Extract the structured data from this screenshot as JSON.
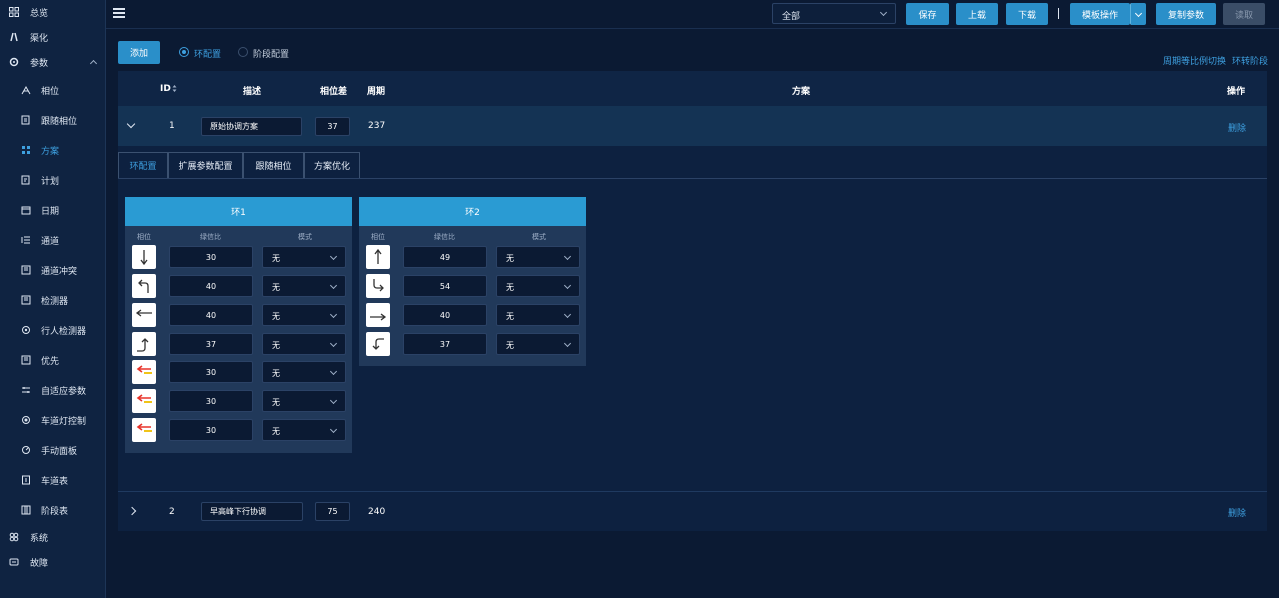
{
  "sidebar": {
    "items": [
      {
        "label": "总览",
        "icon": "grid-icon"
      },
      {
        "label": "渠化",
        "icon": "road-icon"
      },
      {
        "label": "参数",
        "icon": "gear-icon"
      },
      {
        "label": "相位",
        "icon": "phase-icon"
      },
      {
        "label": "跟随相位",
        "icon": "follow-phase-icon"
      },
      {
        "label": "方案",
        "icon": "scheme-icon"
      },
      {
        "label": "计划",
        "icon": "plan-icon"
      },
      {
        "label": "日期",
        "icon": "calendar-icon"
      },
      {
        "label": "通道",
        "icon": "channel-icon"
      },
      {
        "label": "通道冲突",
        "icon": "conflict-icon"
      },
      {
        "label": "检测器",
        "icon": "detector-icon"
      },
      {
        "label": "行人检测器",
        "icon": "pedestrian-detector-icon"
      },
      {
        "label": "优先",
        "icon": "priority-icon"
      },
      {
        "label": "自适应参数",
        "icon": "adaptive-icon"
      },
      {
        "label": "车道灯控制",
        "icon": "lane-light-icon"
      },
      {
        "label": "手动面板",
        "icon": "manual-panel-icon"
      },
      {
        "label": "车道表",
        "icon": "lane-table-icon"
      },
      {
        "label": "阶段表",
        "icon": "stage-table-icon"
      },
      {
        "label": "系统",
        "icon": "system-icon"
      },
      {
        "label": "故障",
        "icon": "fault-icon"
      }
    ]
  },
  "header": {
    "filter_value": "全部",
    "buttons": {
      "save": "保存",
      "upload": "上载",
      "download": "下载",
      "template": "模板操作",
      "copy": "复制参数",
      "read": "读取"
    }
  },
  "toolbar": {
    "add": "添加",
    "radio_ring": "环配置",
    "radio_stage": "阶段配置",
    "link_cycle_switch": "周期等比例切换",
    "link_ring_to_stage": "环转阶段"
  },
  "table": {
    "columns": {
      "id": "ID",
      "desc": "描述",
      "offset": "相位差",
      "cycle": "周期",
      "plan": "方案",
      "action": "操作"
    },
    "rows": [
      {
        "id": "1",
        "desc": "原始协调方案",
        "offset": "37",
        "cycle": "237",
        "action": "删除"
      },
      {
        "id": "2",
        "desc": "早高峰下行协调",
        "offset": "75",
        "cycle": "240",
        "action": "删除"
      }
    ]
  },
  "tabs": [
    "环配置",
    "扩展参数配置",
    "跟随相位",
    "方案优化"
  ],
  "rings": [
    {
      "title": "环1",
      "col_phase": "相位",
      "col_split": "绿信比",
      "col_mode": "模式",
      "phases": [
        {
          "icon": "straight-down-arrow-icon",
          "split": "30",
          "mode": "无"
        },
        {
          "icon": "left-turn-arrow-icon",
          "split": "40",
          "mode": "无"
        },
        {
          "icon": "straight-left-arrow-icon",
          "split": "40",
          "mode": "无"
        },
        {
          "icon": "right-turn-up-arrow-icon",
          "split": "37",
          "mode": "无"
        },
        {
          "icon": "pedestrian-left-arrow-icon",
          "split": "30",
          "mode": "无"
        },
        {
          "icon": "pedestrian-left-arrow-icon",
          "split": "30",
          "mode": "无"
        },
        {
          "icon": "pedestrian-left-arrow-icon",
          "split": "30",
          "mode": "无"
        }
      ]
    },
    {
      "title": "环2",
      "col_phase": "相位",
      "col_split": "绿信比",
      "col_mode": "模式",
      "phases": [
        {
          "icon": "straight-up-arrow-icon",
          "split": "49",
          "mode": "无"
        },
        {
          "icon": "right-turn-down-arrow-icon",
          "split": "54",
          "mode": "无"
        },
        {
          "icon": "straight-right-arrow-icon",
          "split": "40",
          "mode": "无"
        },
        {
          "icon": "left-turn-down-arrow-icon",
          "split": "37",
          "mode": "无"
        }
      ]
    }
  ],
  "colors": {
    "accent": "#2a8fc9",
    "ring_header": "#2a9bd3",
    "link": "#3ea0e0",
    "background": "#0b1a33"
  }
}
